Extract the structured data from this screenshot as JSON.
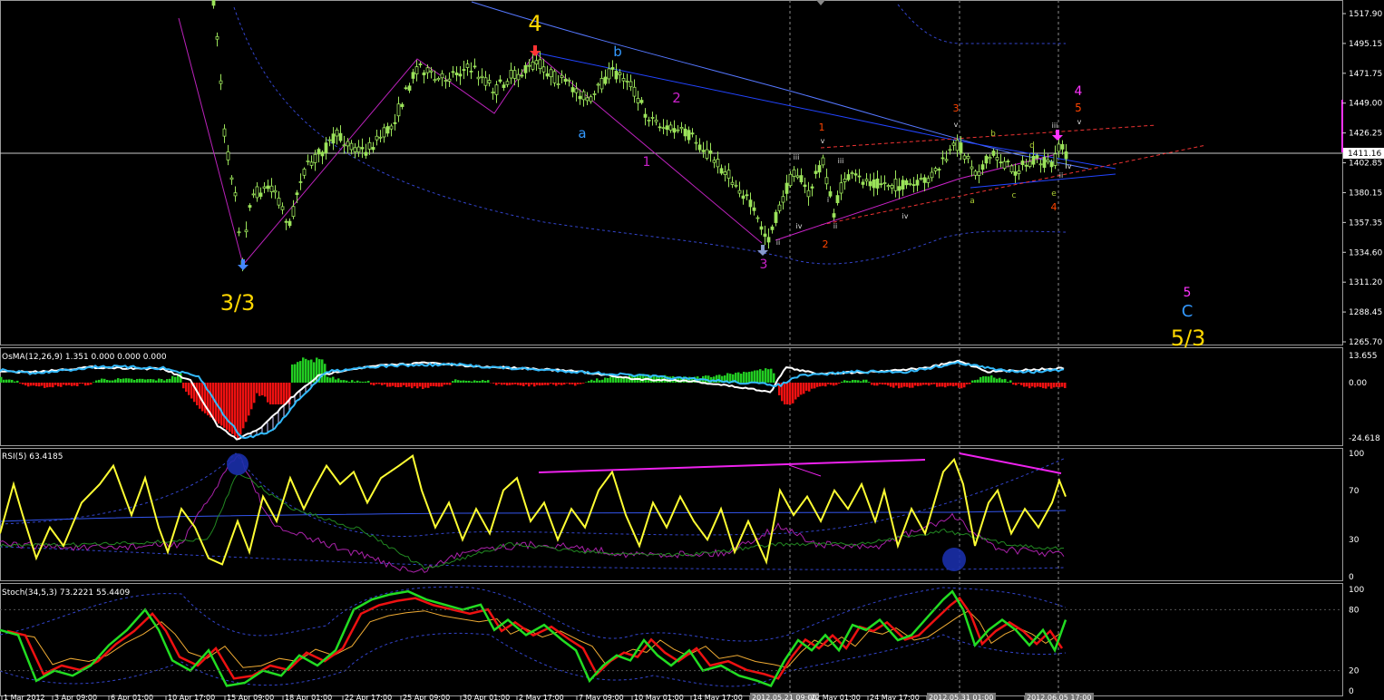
{
  "chart_data": [
    {
      "type": "candlestick",
      "panel": "price",
      "yticks": [
        "1517.90",
        "1495.15",
        "1471.75",
        "1449.00",
        "1426.25",
        "1402.85",
        "1380.15",
        "1357.35",
        "1334.60",
        "1311.20",
        "1288.45",
        "1265.70"
      ],
      "current_price": "1411.16",
      "wave_labels": [
        {
          "text": "4",
          "color": "#ffd700"
        },
        {
          "text": "3/3",
          "color": "#ffd700"
        },
        {
          "text": "a",
          "color": "#3399ff"
        },
        {
          "text": "b",
          "color": "#3399ff"
        },
        {
          "text": "1",
          "color": "#cc22cc"
        },
        {
          "text": "2",
          "color": "#cc22cc"
        },
        {
          "text": "3",
          "color": "#cc22cc"
        },
        {
          "text": "1",
          "color": "#ff4400"
        },
        {
          "text": "2",
          "color": "#ff4400"
        },
        {
          "text": "3",
          "color": "#ff4400"
        },
        {
          "text": "4",
          "color": "#ff4400"
        },
        {
          "text": "5",
          "color": "#ff4400"
        },
        {
          "text": "4",
          "color": "#ff33ff"
        },
        {
          "text": "5",
          "color": "#ff33ff"
        },
        {
          "text": "C",
          "color": "#3399ff"
        },
        {
          "text": "5/3",
          "color": "#ffd700"
        },
        {
          "text": "a",
          "color": "#aacc33"
        },
        {
          "text": "b",
          "color": "#aacc33"
        },
        {
          "text": "c",
          "color": "#aacc33"
        },
        {
          "text": "d",
          "color": "#aacc33"
        },
        {
          "text": "e",
          "color": "#aacc33"
        },
        {
          "text": "v",
          "color": "#dddddd"
        },
        {
          "text": "ii",
          "color": "#dddddd"
        },
        {
          "text": "iii",
          "color": "#dddddd"
        },
        {
          "text": "iv",
          "color": "#dddddd"
        },
        {
          "text": "i",
          "color": "#dddddd"
        },
        {
          "text": "ii",
          "color": "#dddddd"
        },
        {
          "text": "iii",
          "color": "#dddddd"
        },
        {
          "text": "iv",
          "color": "#dddddd"
        },
        {
          "text": "v",
          "color": "#dddddd"
        },
        {
          "text": "iii",
          "color": "#dddddd"
        },
        {
          "text": "iv",
          "color": "#dddddd"
        },
        {
          "text": "ii",
          "color": "#dddddd"
        },
        {
          "text": "v",
          "color": "#dddddd"
        }
      ]
    },
    {
      "type": "histogram",
      "panel": "osma",
      "label": "OsMA(12,26,9) 1.351 0.000 0.000 0.000",
      "yticks": [
        "13.655",
        "0.00",
        "-24.618"
      ]
    },
    {
      "type": "line",
      "panel": "rsi",
      "label": "RSI(5) 63.4185",
      "yticks": [
        "100",
        "70",
        "30",
        "0"
      ]
    },
    {
      "type": "line",
      "panel": "stoch",
      "label": "Stoch(34,5,3) 73.2221 55.4409",
      "yticks": [
        "100",
        "80",
        "20",
        "0"
      ]
    }
  ],
  "x_dates": [
    "1 Mar 2012",
    "3 Apr 09:00",
    "6 Apr 01:00",
    "10 Apr 17:00",
    "15 Apr 09:00",
    "18 Apr 01:00",
    "22 Apr 17:00",
    "25 Apr 09:00",
    "30 Apr 01:00",
    "2 May 17:00",
    "7 May 09:00",
    "10 May 01:00",
    "14 May 17:00",
    "2012.05.21 09:00",
    "22 May 01:00",
    "24 May 17:00",
    "2012.05.31 01:00",
    "2012.06.05 17:00"
  ],
  "colors": {
    "bull": "#9be35a",
    "bear": "#e82020",
    "osma_green": "#22cc22",
    "macd_main": "#ffffff",
    "macd_signal": "#33bbff",
    "rsi": "#ffff33",
    "stoch_main": "#22dd22",
    "stoch_signal": "#ee1111"
  }
}
